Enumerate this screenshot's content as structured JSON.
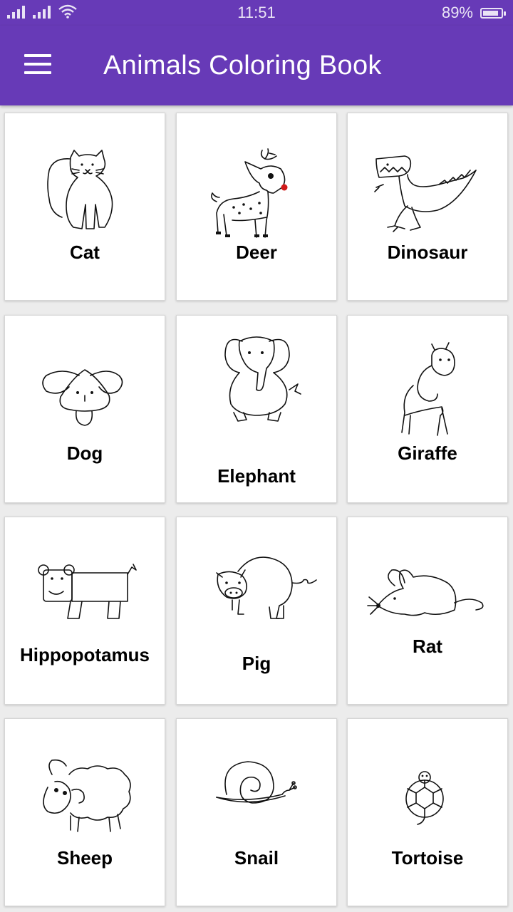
{
  "status_bar": {
    "time": "11:51",
    "battery_percent": "89%",
    "battery_level": 0.89,
    "icons": [
      "signal-icon",
      "signal-icon",
      "wifi-icon",
      "battery-icon"
    ]
  },
  "app_bar": {
    "title": "Animals Coloring Book",
    "menu_icon": "hamburger-menu-icon",
    "color": "#673ab7"
  },
  "animals": [
    {
      "label": "Cat"
    },
    {
      "label": "Deer"
    },
    {
      "label": "Dinosaur"
    },
    {
      "label": "Dog"
    },
    {
      "label": "Elephant"
    },
    {
      "label": "Giraffe"
    },
    {
      "label": "Hippopotamus"
    },
    {
      "label": "Pig"
    },
    {
      "label": "Rat"
    },
    {
      "label": "Sheep"
    },
    {
      "label": "Snail"
    },
    {
      "label": "Tortoise"
    }
  ]
}
